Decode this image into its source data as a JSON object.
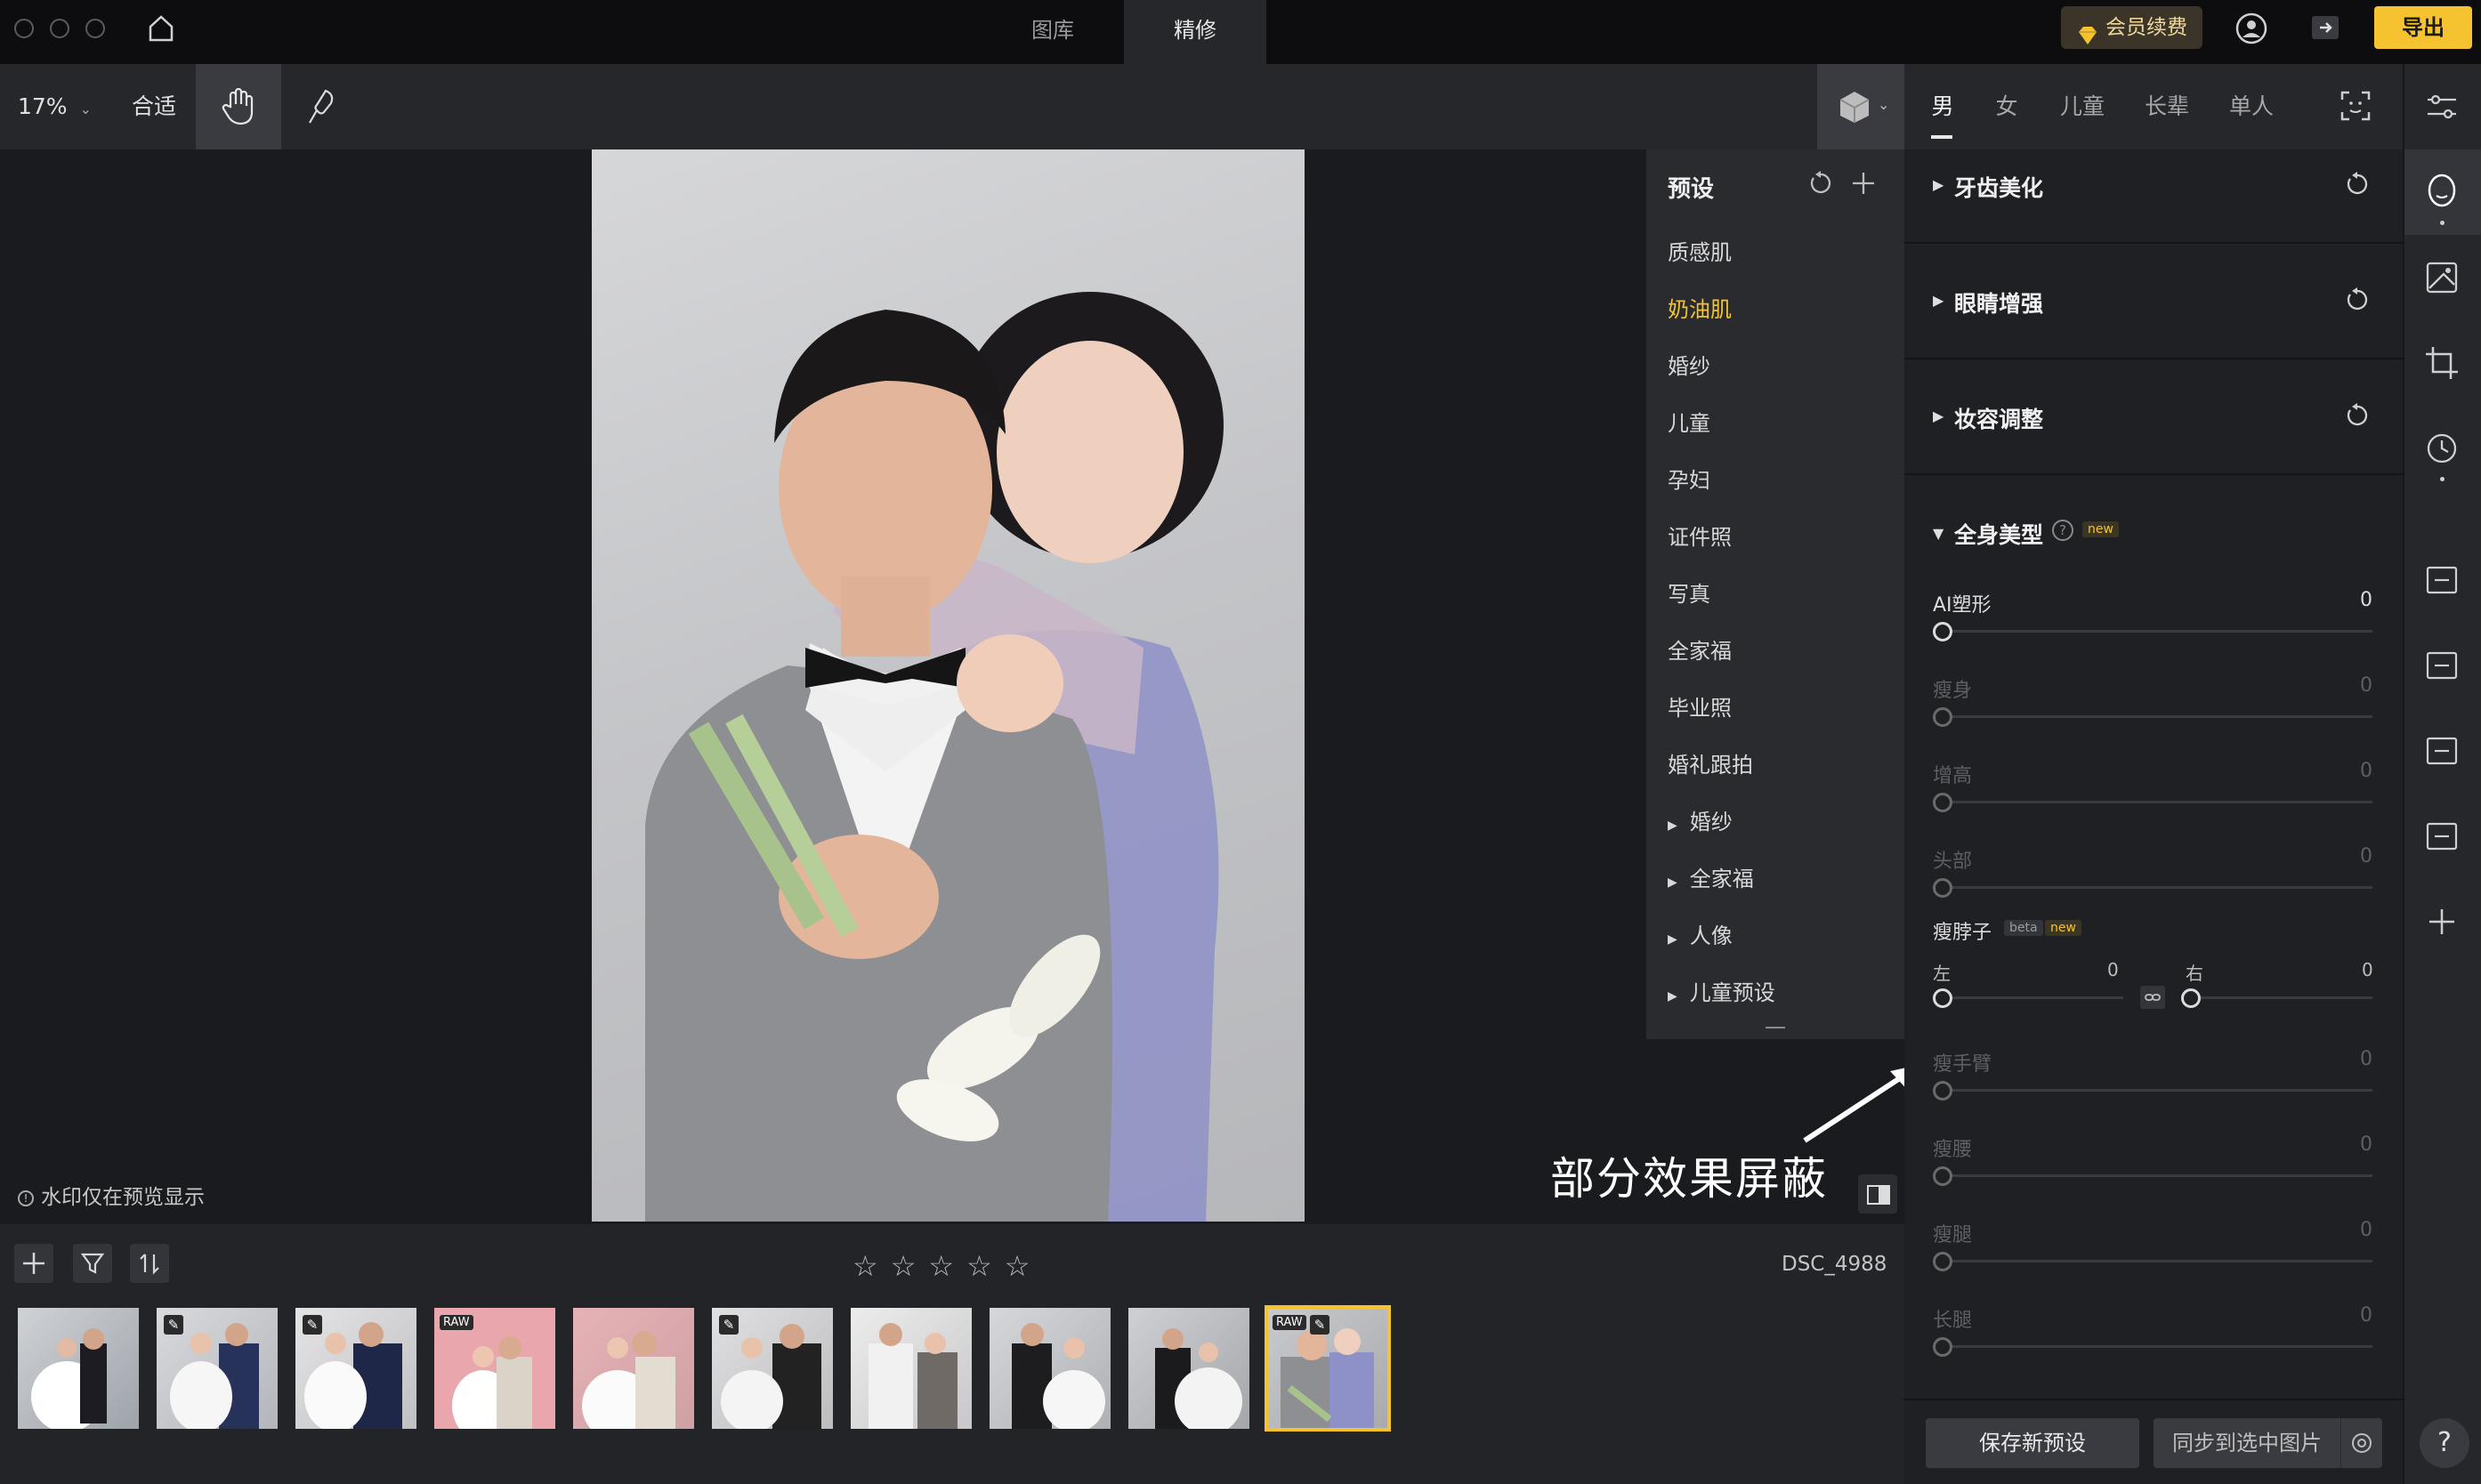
{
  "titlebar": {
    "tabs": [
      {
        "label": "图库",
        "active": false
      },
      {
        "label": "精修",
        "active": true
      }
    ],
    "vip_label": "会员续费",
    "export_label": "导出"
  },
  "toolbar": {
    "zoom": "17%",
    "fit_label": "合适"
  },
  "gender_tabs": [
    {
      "label": "男",
      "active": true
    },
    {
      "label": "女",
      "active": false
    },
    {
      "label": "儿童",
      "active": false
    },
    {
      "label": "长辈",
      "active": false
    },
    {
      "label": "单人",
      "active": false
    }
  ],
  "presets": {
    "title": "预设",
    "items": [
      "质感肌",
      "奶油肌",
      "婚纱",
      "儿童",
      "孕妇",
      "证件照",
      "写真",
      "全家福",
      "毕业照",
      "婚礼跟拍"
    ],
    "selected": "奶油肌",
    "groups": [
      "婚纱",
      "全家福",
      "人像",
      "儿童预设"
    ]
  },
  "canvas": {
    "watermark_note": "水印仅在预览显示",
    "annotation": "部分效果屏蔽"
  },
  "filmstrip": {
    "filename": "DSC_4988",
    "rating_stars": 0,
    "rating_max": 5,
    "raw_badge": "RAW"
  },
  "panel": {
    "sections": [
      {
        "title": "牙齿美化",
        "expanded": false
      },
      {
        "title": "眼睛增强",
        "expanded": false
      },
      {
        "title": "妆容调整",
        "expanded": false
      },
      {
        "title": "全身美型",
        "expanded": true,
        "tag": "new"
      }
    ],
    "sliders": [
      {
        "label": "AI塑形",
        "value": "0",
        "enabled": true
      },
      {
        "label": "瘦身",
        "value": "0",
        "enabled": false
      },
      {
        "label": "增高",
        "value": "0",
        "enabled": false
      },
      {
        "label": "头部",
        "value": "0",
        "enabled": false
      }
    ],
    "neck": {
      "label": "瘦脖子",
      "tag_beta": "beta",
      "tag_new": "new",
      "left_label": "左",
      "left_value": "0",
      "right_label": "右",
      "right_value": "0"
    },
    "sliders2": [
      {
        "label": "瘦手臂",
        "value": "0",
        "enabled": false
      },
      {
        "label": "瘦腰",
        "value": "0",
        "enabled": false
      },
      {
        "label": "瘦腿",
        "value": "0",
        "enabled": false
      },
      {
        "label": "长腿",
        "value": "0",
        "enabled": false
      }
    ],
    "save_preset_label": "保存新预设",
    "sync_label": "同步到选中图片"
  },
  "help_label": "?",
  "colors": {
    "accent": "#f5c330",
    "background": "#1c1d21",
    "panel": "#1f2024"
  }
}
